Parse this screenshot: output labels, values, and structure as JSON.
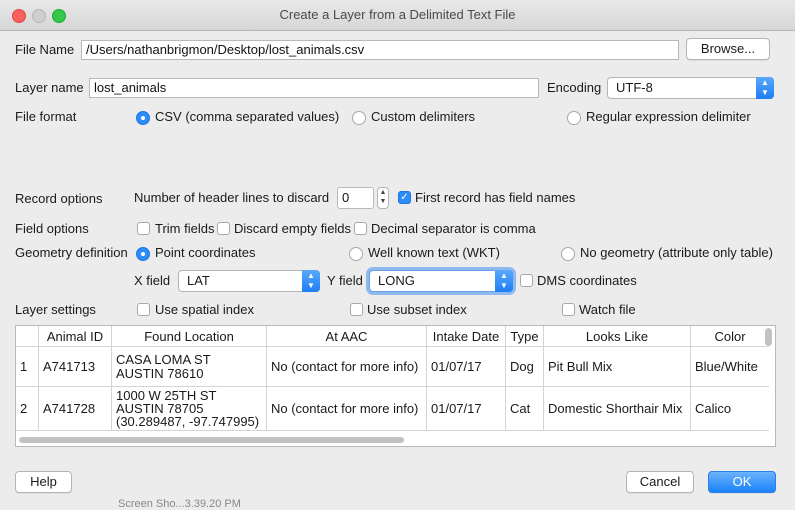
{
  "window": {
    "title": "Create a Layer from a Delimited Text File"
  },
  "file_name": {
    "label": "File Name",
    "value": "/Users/nathanbrigmon/Desktop/lost_animals.csv",
    "browse": "Browse..."
  },
  "layer_name": {
    "label": "Layer name",
    "value": "lost_animals"
  },
  "encoding": {
    "label": "Encoding",
    "value": "UTF-8"
  },
  "file_format": {
    "label": "File format",
    "csv": "CSV (comma separated values)",
    "custom": "Custom delimiters",
    "regex": "Regular expression delimiter",
    "selected": "csv"
  },
  "record_options": {
    "label": "Record options",
    "header_lines_label": "Number of header lines to discard",
    "header_lines_value": "0",
    "first_record_label": "First record has field names",
    "first_record_checked": true
  },
  "field_options": {
    "label": "Field options",
    "trim": "Trim fields",
    "discard_empty": "Discard empty fields",
    "decimal_comma": "Decimal separator is comma"
  },
  "geometry": {
    "label": "Geometry definition",
    "point": "Point coordinates",
    "wkt": "Well known text (WKT)",
    "none": "No geometry (attribute only table)",
    "selected": "point",
    "x_label": "X field",
    "x_value": "LAT",
    "y_label": "Y field",
    "y_value": "LONG",
    "dms": "DMS coordinates"
  },
  "layer_settings": {
    "label": "Layer settings",
    "spatial_index": "Use spatial index",
    "subset_index": "Use subset index",
    "watch_file": "Watch file"
  },
  "table": {
    "headers": [
      "",
      "Animal ID",
      "Found Location",
      "At AAC",
      "Intake Date",
      "Type",
      "Looks Like",
      "Color"
    ],
    "rows": [
      {
        "num": "1",
        "id": "A741713",
        "loc": [
          "CASA LOMA ST",
          "AUSTIN 78610"
        ],
        "aac": "No (contact for more info)",
        "date": "01/07/17",
        "type": "Dog",
        "looks": "Pit Bull Mix",
        "color": "Blue/White"
      },
      {
        "num": "2",
        "id": "A741728",
        "loc": [
          "1000 W 25TH ST",
          "AUSTIN 78705",
          "(30.289487, -97.747995)"
        ],
        "aac": "No (contact for more info)",
        "date": "01/07/17",
        "type": "Cat",
        "looks": "Domestic Shorthair Mix",
        "color": "Calico"
      }
    ]
  },
  "buttons": {
    "help": "Help",
    "cancel": "Cancel",
    "ok": "OK"
  },
  "background_text": "Screen Sho...3.39.20 PM"
}
